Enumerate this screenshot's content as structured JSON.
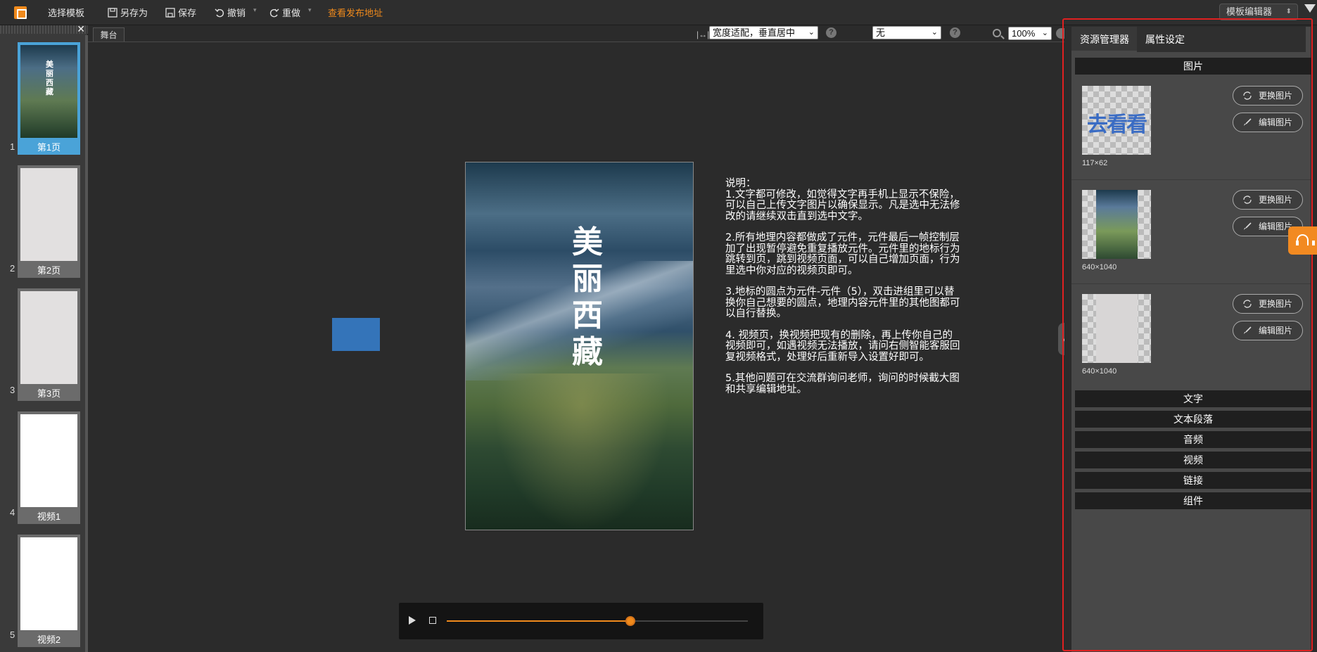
{
  "toolbar": {
    "select_template": "选择模板",
    "save_as": "另存为",
    "save": "保存",
    "undo": "撤销",
    "redo": "重做",
    "view_publish": "查看发布地址",
    "template_editor": "模板编辑器",
    "accent_color": "#f08a1c"
  },
  "pages": [
    {
      "num": "1",
      "label": "第1页",
      "selected": true
    },
    {
      "num": "2",
      "label": "第2页"
    },
    {
      "num": "3",
      "label": "第3页"
    },
    {
      "num": "4",
      "label": "视频1"
    },
    {
      "num": "5",
      "label": "视频2"
    }
  ],
  "page1_thumb_text": "美\n丽\n西\n藏",
  "stage": {
    "tab": "舞台",
    "fit_mode": "宽度适配，垂直居中",
    "effect": "无",
    "zoom": "100%",
    "help": "?",
    "phone_title": "美\n丽\n西\n藏"
  },
  "description": {
    "head": "说明：",
    "items": [
      "1.文字都可修改，如觉得文字再手机上显示不保险，可以自己上传文字图片以确保显示。凡是选中无法修改的请继续双击直到选中文字。",
      "2.所有地理内容都做成了元件，元件最后一帧控制层加了出现暂停避免重复播放元件。元件里的地标行为跳转到页，跳到视频页面，可以自己增加页面，行为里选中你对应的视频页即可。",
      "3.地标的圆点为元件-元件（5），双击进组里可以替换你自己想要的圆点，地理内容元件里的其他图都可以自行替换。",
      "4. 视频页，换视频把现有的删除，再上传你自己的视频即可，如遇视频无法播放，请问右侧智能客服回复视频格式，处理好后重新导入设置好即可。",
      "5.其他问题可在交流群询问老师，询问的时候截大图和共享编辑地址。"
    ]
  },
  "player": {
    "progress": 0.61
  },
  "panel": {
    "tab_resources": "资源管理器",
    "tab_props": "属性设定",
    "section_images": "图片",
    "assets": [
      {
        "dim": "117×62",
        "replace": "更换图片",
        "edit": "编辑图片",
        "logo_text": "去看看"
      },
      {
        "dim": "640×1040",
        "replace": "更换图片",
        "edit": "编辑图片"
      },
      {
        "dim": "640×1040",
        "replace": "更换图片",
        "edit": "编辑图片"
      }
    ],
    "sections": [
      "文字",
      "文本段落",
      "音频",
      "视频",
      "链接",
      "组件"
    ]
  }
}
